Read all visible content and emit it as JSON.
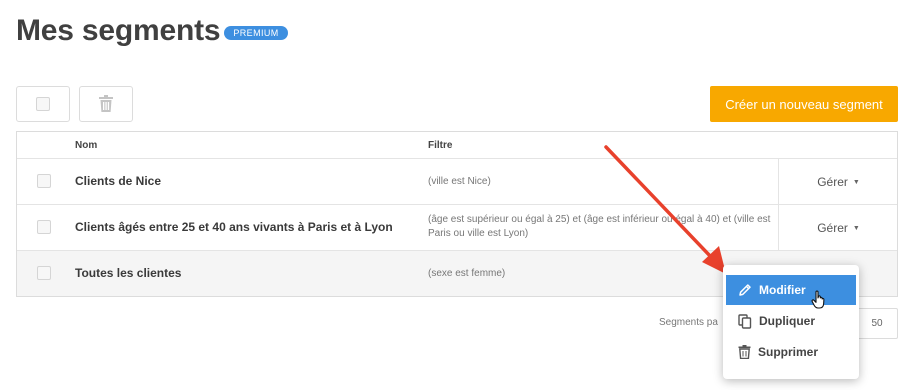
{
  "header": {
    "title": "Mes segments",
    "badge": "PREMIUM"
  },
  "toolbar": {
    "create_label": "Créer un nouveau segment"
  },
  "table": {
    "columns": {
      "name": "Nom",
      "filter": "Filtre"
    },
    "rows": [
      {
        "name": "Clients de Nice",
        "filter": "(ville est Nice)",
        "action": "Gérer"
      },
      {
        "name": "Clients âgés entre 25 et 40 ans vivants à Paris et à Lyon",
        "filter": "(âge est supérieur ou égal à 25) et (âge est inférieur ou égal à 40) et (ville est Paris ou ville est Lyon)",
        "action": "Gérer"
      },
      {
        "name": "Toutes les clientes",
        "filter": "(sexe est femme)",
        "action": ""
      }
    ]
  },
  "pagination": {
    "label": "Segments pa",
    "per_page": "50"
  },
  "context_menu": {
    "items": [
      {
        "label": "Modifier",
        "icon": "pencil-icon"
      },
      {
        "label": "Dupliquer",
        "icon": "copy-icon"
      },
      {
        "label": "Supprimer",
        "icon": "trash-icon"
      }
    ]
  },
  "colors": {
    "accent": "#f8a800",
    "primary": "#3d8fe0",
    "annotation_arrow": "#e8412c"
  }
}
